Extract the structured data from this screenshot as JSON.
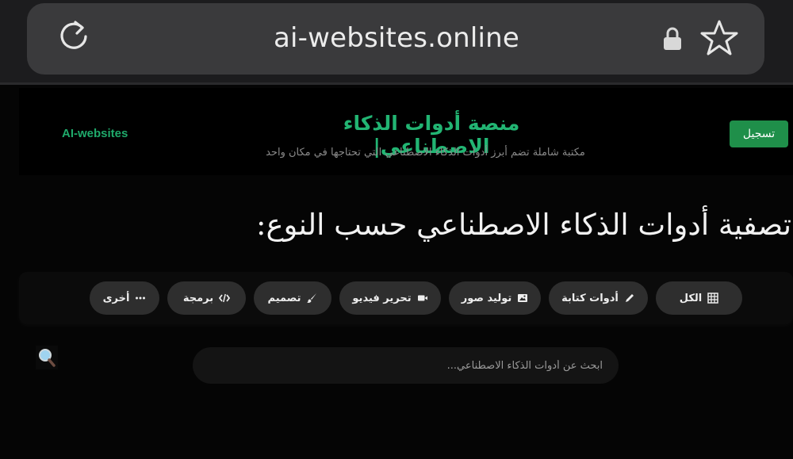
{
  "browser": {
    "url": "ai-websites.online"
  },
  "header": {
    "brand": "AI-websites",
    "title": "منصة أدوات الذكاء الاصطناعي|",
    "subtitle": "مكتبة شاملة تضم أبرز أدوات الذكاء الاصطناعي التي تحتاجها في مكان واحد",
    "register_label": "تسجيل"
  },
  "filter": {
    "heading": "تصفية أدوات الذكاء الاصطناعي حسب النوع:",
    "chips": [
      {
        "label": "الكل",
        "icon": "grid-icon"
      },
      {
        "label": "أدوات كتابة",
        "icon": "pencil-icon"
      },
      {
        "label": "توليد صور",
        "icon": "image-icon"
      },
      {
        "label": "تحرير فيديو",
        "icon": "video-camera-icon"
      },
      {
        "label": "تصميم",
        "icon": "brush-icon"
      },
      {
        "label": "برمجة",
        "icon": "code-icon"
      },
      {
        "label": "أخرى",
        "icon": "more-icon"
      }
    ]
  },
  "search": {
    "placeholder": "ابحث عن أدوات الذكاء الاصطناعي...",
    "icon": "magnifier-icon"
  },
  "colors": {
    "accent": "#22b573",
    "register_button": "#1f8f4a",
    "chip_bg": "#2e2e2e"
  }
}
